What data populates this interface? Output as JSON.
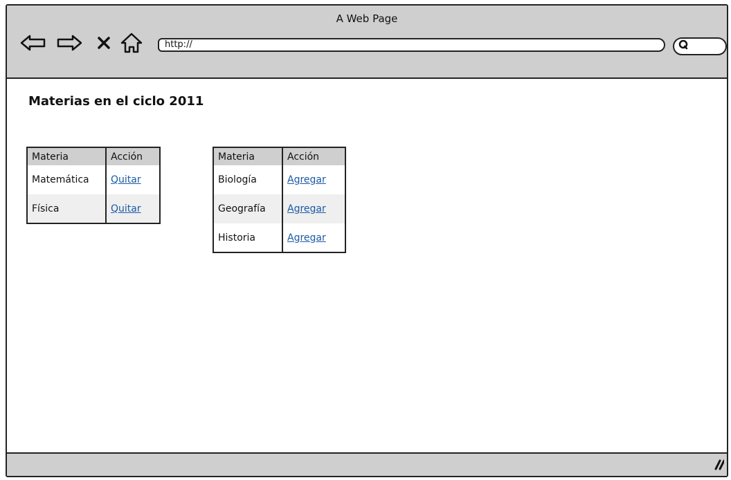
{
  "window": {
    "title": "A Web Page"
  },
  "toolbar": {
    "back_icon": "back-arrow-icon",
    "forward_icon": "forward-arrow-icon",
    "stop_icon": "close-icon",
    "home_icon": "home-icon",
    "search_icon": "search-icon"
  },
  "address_bar": {
    "url": "http://"
  },
  "page": {
    "heading": "Materias en el ciclo 2011"
  },
  "enrolled_table": {
    "columns": [
      "Materia",
      "Acción"
    ],
    "rows": [
      {
        "subject": "Matemática",
        "action": "Quitar"
      },
      {
        "subject": "Física",
        "action": "Quitar"
      }
    ]
  },
  "available_table": {
    "columns": [
      "Materia",
      "Acción"
    ],
    "rows": [
      {
        "subject": "Biología",
        "action": "Agregar"
      },
      {
        "subject": "Geografía",
        "action": "Agregar"
      },
      {
        "subject": "Historia",
        "action": "Agregar"
      }
    ]
  },
  "colors": {
    "chrome": "#cfcfcf",
    "link": "#1a5aa6",
    "alt_row": "#efefef"
  }
}
